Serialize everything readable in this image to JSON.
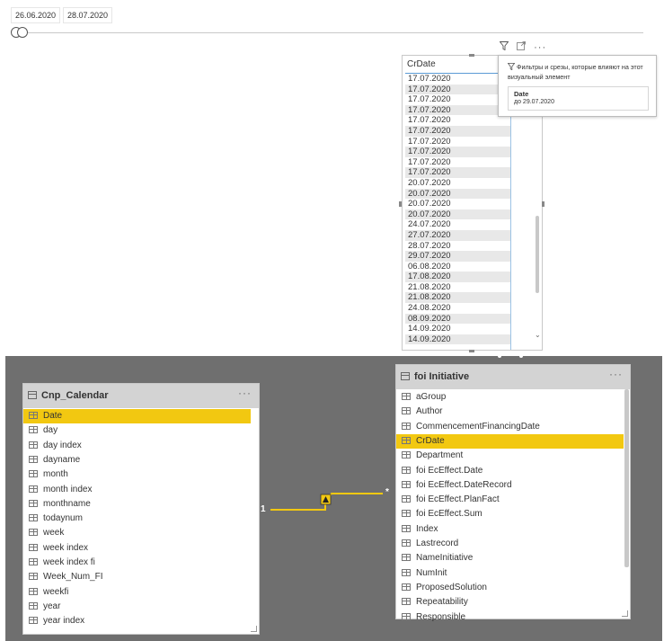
{
  "date_slicer": {
    "start_date": "26.06.2020",
    "end_date": "28.07.2020"
  },
  "table_visual": {
    "column_header": "CrDate",
    "rows": [
      "17.07.2020",
      "17.07.2020",
      "17.07.2020",
      "17.07.2020",
      "17.07.2020",
      "17.07.2020",
      "17.07.2020",
      "17.07.2020",
      "17.07.2020",
      "17.07.2020",
      "20.07.2020",
      "20.07.2020",
      "20.07.2020",
      "20.07.2020",
      "24.07.2020",
      "27.07.2020",
      "28.07.2020",
      "29.07.2020",
      "06.08.2020",
      "17.08.2020",
      "21.08.2020",
      "21.08.2020",
      "24.08.2020",
      "08.09.2020",
      "14.09.2020",
      "14.09.2020"
    ],
    "header_icons": [
      "filter-icon",
      "focus-mode-icon",
      "more-options-icon"
    ]
  },
  "tooltip": {
    "title": "Фильтры и срезы, которые влияют на этот визуальный элемент",
    "filter_name": "Date",
    "filter_value": "до 29.07.2020"
  },
  "model": {
    "left_table": {
      "name": "Cnp_Calendar",
      "fields": [
        "Date",
        "day",
        "day index",
        "dayname",
        "month",
        "month index",
        "monthname",
        "todaynum",
        "week",
        "week index",
        "week index fi",
        "Week_Num_FI",
        "weekfi",
        "year",
        "year index"
      ],
      "selected_field": "Date"
    },
    "right_table": {
      "name": "foi Initiative",
      "fields": [
        "aGroup",
        "Author",
        "CommencementFinancingDate",
        "CrDate",
        "Department",
        "foi EcEffect.Date",
        "foi EcEffect.DateRecord",
        "foi EcEffect.PlanFact",
        "foi EcEffect.Sum",
        "Index",
        "Lastrecord",
        "NameInitiative",
        "NumInit",
        "ProposedSolution",
        "Repeatability",
        "Responsible"
      ],
      "selected_field": "CrDate"
    },
    "relationship": {
      "one_side": "1",
      "many_side": "*"
    },
    "card_menu_label": "···",
    "colors": {
      "canvas": "#6f6f6f",
      "selection": "#f2c811",
      "card_header": "#d3d3d3"
    }
  }
}
